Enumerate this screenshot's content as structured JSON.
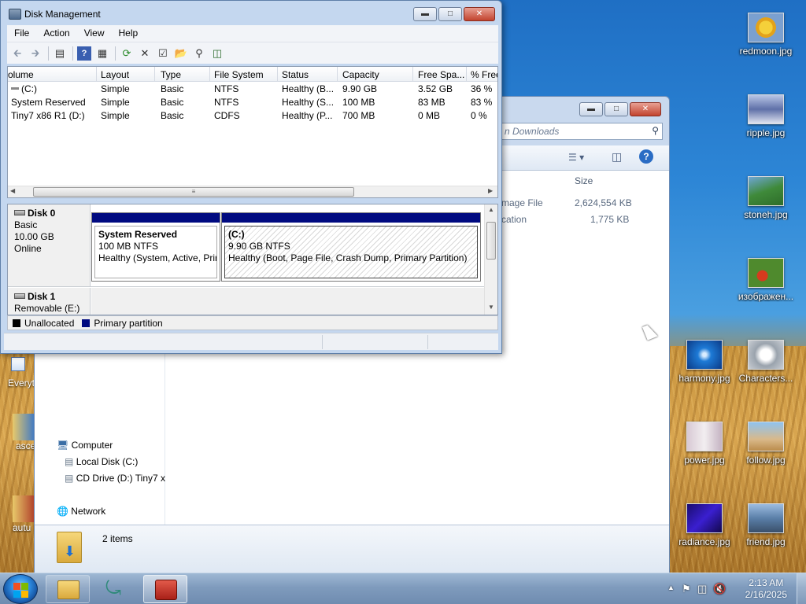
{
  "desktop": {
    "icons": [
      {
        "label": "redmoon.jpg"
      },
      {
        "label": "ripple.jpg"
      },
      {
        "label": "stoneh.jpg"
      },
      {
        "label": "изображен..."
      },
      {
        "label": "harmony.jpg"
      },
      {
        "label": "Characters..."
      },
      {
        "label": "power.jpg"
      },
      {
        "label": "follow.jpg"
      },
      {
        "label": "radiance.jpg"
      },
      {
        "label": "friend.jpg"
      }
    ],
    "left_icons": [
      {
        "label": "Everyt"
      },
      {
        "label": "asce"
      },
      {
        "label": "autu"
      }
    ]
  },
  "explorer": {
    "search_placeholder": "n Downloads",
    "column_size": "Size",
    "rows": [
      {
        "name": "mage File",
        "size": "2,624,554 KB"
      },
      {
        "name": "cation",
        "size": "1,775 KB"
      }
    ],
    "nav": {
      "computer": "Computer",
      "local_disk": "Local Disk (C:)",
      "cd_drive": "CD Drive (D:) Tiny7 x",
      "network": "Network"
    },
    "details": {
      "count": "2 items"
    }
  },
  "disk_mgmt": {
    "title": "Disk Management",
    "menu": [
      "File",
      "Action",
      "View",
      "Help"
    ],
    "columns": [
      "olume",
      "Layout",
      "Type",
      "File System",
      "Status",
      "Capacity",
      "Free Spa...",
      "% Free"
    ],
    "volumes": [
      {
        "volume": "(C:)",
        "layout": "Simple",
        "type": "Basic",
        "fs": "NTFS",
        "status": "Healthy (B...",
        "capacity": "9.90 GB",
        "free": "3.52 GB",
        "pct": "36 %"
      },
      {
        "volume": "System Reserved",
        "layout": "Simple",
        "type": "Basic",
        "fs": "NTFS",
        "status": "Healthy (S...",
        "capacity": "100 MB",
        "free": "83 MB",
        "pct": "83 %"
      },
      {
        "volume": "Tiny7 x86 R1 (D:)",
        "layout": "Simple",
        "type": "Basic",
        "fs": "CDFS",
        "status": "Healthy (P...",
        "capacity": "700 MB",
        "free": "0 MB",
        "pct": "0 %"
      }
    ],
    "disks": [
      {
        "name": "Disk 0",
        "type": "Basic",
        "size": "10.00 GB",
        "state": "Online"
      },
      {
        "name": "Disk 1",
        "type": "Removable (E:)"
      }
    ],
    "partitions": [
      {
        "name": "System Reserved",
        "size": "100 MB NTFS",
        "status": "Healthy (System, Active, Prir"
      },
      {
        "name": "(C:)",
        "size": "9.90 GB NTFS",
        "status": "Healthy (Boot, Page File, Crash Dump, Primary Partition)"
      }
    ],
    "legend": {
      "unallocated": "Unallocated",
      "primary": "Primary partition"
    },
    "colors": {
      "unallocated": "#000000",
      "primary": "#000a80"
    }
  },
  "taskbar": {
    "clock_time": "2:13 AM",
    "clock_date": "2/16/2025"
  }
}
